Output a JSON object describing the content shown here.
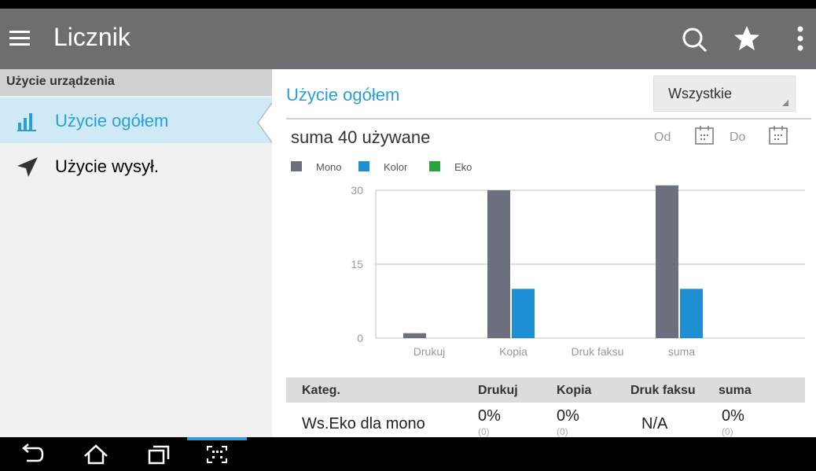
{
  "appbar": {
    "title": "Licznik",
    "icons": [
      "menu-icon",
      "search-icon",
      "star-icon",
      "more-vert-icon"
    ]
  },
  "sidebar": {
    "header": "Użycie urządzenia",
    "items": [
      {
        "label": "Użycie ogółem",
        "icon": "bar-chart-icon",
        "active": true
      },
      {
        "label": "Użycie wysył.",
        "icon": "send-icon",
        "active": false
      }
    ]
  },
  "main": {
    "title": "Użycie ogółem",
    "filter": "Wszystkie",
    "total": "suma 40 używane",
    "from_label": "Od",
    "to_label": "Do"
  },
  "chart_data": {
    "type": "bar",
    "categories": [
      "Drukuj",
      "Kopia",
      "Druk faksu",
      "suma"
    ],
    "series": [
      {
        "name": "Mono",
        "color": "#6c6f7d",
        "values": [
          1,
          30,
          0,
          31
        ]
      },
      {
        "name": "Kolor",
        "color": "#1e8fd2",
        "values": [
          0,
          10,
          0,
          10
        ]
      },
      {
        "name": "Eko",
        "color": "#2aa33a",
        "values": [
          0,
          0,
          0,
          0
        ]
      }
    ],
    "yticks": [
      30,
      15,
      0
    ],
    "ylim": [
      0,
      30
    ],
    "grid": true,
    "legend": "top-left"
  },
  "table": {
    "headers": [
      "Kateg.",
      "Drukuj",
      "Kopia",
      "Druk faksu",
      "suma"
    ],
    "rows": [
      {
        "category": "Ws.Eko dla mono",
        "print": "0%",
        "print_sub": "(0)",
        "copy": "0%",
        "copy_sub": "(0)",
        "fax": "N/A",
        "total": "0%",
        "total_sub": "(0)"
      }
    ]
  },
  "navbar": {
    "icons": [
      "back-icon",
      "home-icon",
      "recent-apps-icon",
      "screen-capture-icon"
    ]
  }
}
